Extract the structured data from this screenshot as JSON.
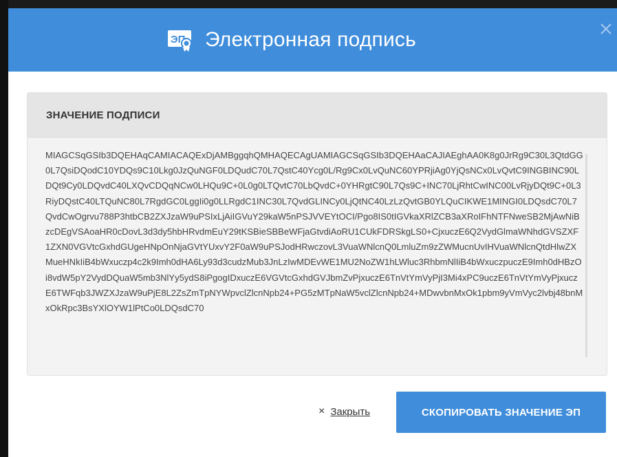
{
  "modal": {
    "title": "Электронная подпись",
    "icon": "signature-certificate-icon",
    "close_icon": "close-icon",
    "accent_color": "#3f8ddb"
  },
  "signature_panel": {
    "heading": "ЗНАЧЕНИЕ ПОДПИСИ",
    "value": "MIAGCSqGSIb3DQEHAqCAMIACAQExDjAMBggqhQMHAQECAgUAMIAGCSqGSIb3DQEHAaCAJIAEghAA0K8g0JrRg9C30L3QtdGG0L7QsiDQodC10YDQs9C10Lkg0JzQuNGF0LDQudC70L7QstC40Ycg0L/Rg9Cx0LvQuNC60YPRjiAg0YjQsNCx0LvQvtC9INGBINC90LDQt9Cy0LDQvdC40LXQvCDQqNCw0LHQu9C+0L0g0LTQvtC70LbQvdC+0YHRgtC90L7Qs9C+INC70LjRhtCwINC00LvRjyDQt9C+0L3RiyDQstC40LTQuNC80L7RgdGC0LggIi0g0LLRgdC1INC30L7QvdGLINCy0LjQtNC40LzLzQvtGB0YLQuCIKWE1MINGI0LDQsdC70L7QvdCwOgrvu788P3htbCB2ZXJzaW9uPSIxLjAiIGVuY29kaW5nPSJVVEYtOCI/Pgo8IS0tIGVkaXRlZCB3aXRoIFhNTFNweSB2MjAwNiBzcDEgVSAoaHR0cDovL3d3dy5hbHRvdmEuY29tKSBieSBBeWFjaGtvdiAoRU1CUkFDRSkgLS0+CjxuczE6Q2VydGlmaWNhdGVSZXF1ZXN0VGVtcGxhdGUgeHNpOnNjaGVtYUxvY2F0aW9uPSJodHRwczovL3VuaWNlcnQ0LmluZm9zZWMucnUvIHVuaWNlcnQtdHlwZXMueHNkIiB4bWxuczp4c2k9Imh0dHA6Ly93d3cudzMub3JnLzIwMDEvWE1MU2NoZW1hLWluc3RhbmNlIiB4bWxuczpuczE9Imh0dHBzOi8vdW5pY2VydDQuaW5mb3NlYy5ydS8iPgogIDxuczE6VGVtcGxhdGVJbmZvPjxuczE6TnVtYmVyPjI3Mi4xPC9uczE6TnVtYmVyPjxuczE6TWFqb3JWZXJzaW9uPjE8L2ZsZmTpNYWpvclZlcnNpb24+PG5zMTpNaW5vclZlcnNpb24+MDwvbnMxOk1pbm9yVmVyc2lvbj48bnMxOkRpc3BsYXlOYW1lPtCo0LDQsdC70"
  },
  "footer": {
    "close_label": "Закрыть",
    "close_glyph": "×",
    "copy_button_label": "СКОПИРОВАТЬ ЗНАЧЕНИЕ ЭП"
  }
}
